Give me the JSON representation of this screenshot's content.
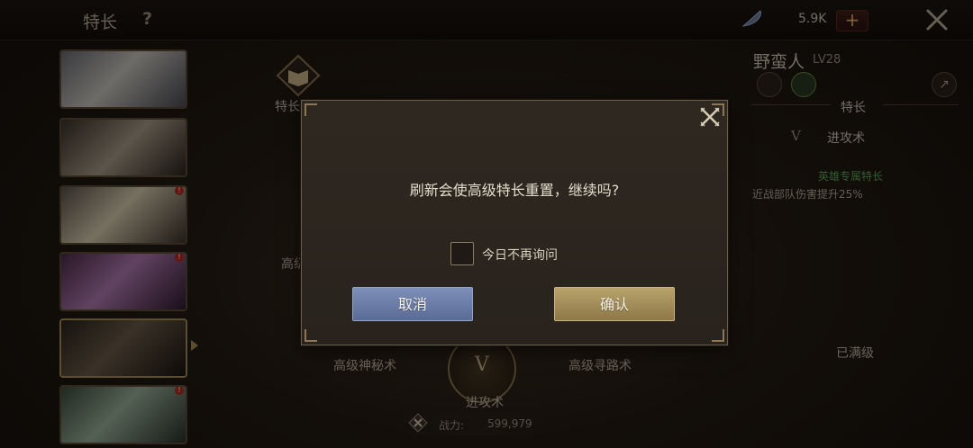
{
  "topbar": {
    "title": "特长",
    "help": "?",
    "currency": "5.9K",
    "plus": "+"
  },
  "hero_list": [
    {
      "badge": ""
    },
    {
      "badge": ""
    },
    {
      "badge": "!"
    },
    {
      "badge": "!"
    },
    {
      "badge": "",
      "selected": true
    },
    {
      "badge": "!"
    }
  ],
  "tree": {
    "top_node": "特长",
    "left_partial": "高级",
    "left_node": "高级神秘术",
    "right_node": "高级寻路术",
    "center_node": "进攻术",
    "center_rank": "V"
  },
  "power": {
    "label": "战力:",
    "value": "599,979"
  },
  "right_panel": {
    "hero_name": "野蛮人",
    "hero_level": "LV28",
    "section_title": "特长",
    "rank": "V",
    "skill_name": "进攻术",
    "exclusive": "英雄专属特长",
    "effect": "近战部队伤害提升25%",
    "status": "已满级"
  },
  "dialog": {
    "message": "刷新会使高级特长重置，继续吗?",
    "checkbox_label": "今日不再询问",
    "checkbox_checked": false,
    "cancel_label": "取消",
    "confirm_label": "确认"
  },
  "colors": {
    "cancel_button": "#6a7ca6",
    "confirm_button": "#a48e5c",
    "exclusive_text": "#5aa858",
    "badge": "#b42a20"
  }
}
